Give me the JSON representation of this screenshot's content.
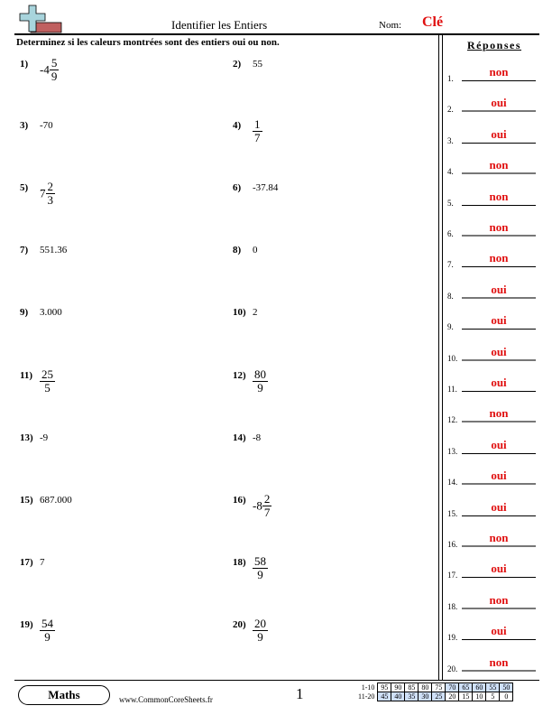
{
  "header": {
    "title": "Identifier les Entiers",
    "name_label": "Nom:",
    "name_value": "Clé",
    "instructions": "Determinez si les caleurs montrées sont des entiers oui ou non."
  },
  "questions": [
    {
      "number": "1)",
      "type": "mixed",
      "whole": "-4",
      "numerator": "5",
      "denominator": "9"
    },
    {
      "number": "2)",
      "type": "text",
      "value": "55"
    },
    {
      "number": "3)",
      "type": "text",
      "value": "-70"
    },
    {
      "number": "4)",
      "type": "fraction",
      "numerator": "1",
      "denominator": "7"
    },
    {
      "number": "5)",
      "type": "mixed",
      "whole": "7",
      "numerator": "2",
      "denominator": "3"
    },
    {
      "number": "6)",
      "type": "text",
      "value": "-37.84"
    },
    {
      "number": "7)",
      "type": "text",
      "value": "551.36"
    },
    {
      "number": "8)",
      "type": "text",
      "value": "0"
    },
    {
      "number": "9)",
      "type": "text",
      "value": "3.000"
    },
    {
      "number": "10)",
      "type": "text",
      "value": "2"
    },
    {
      "number": "11)",
      "type": "fraction",
      "numerator": "25",
      "denominator": "5"
    },
    {
      "number": "12)",
      "type": "fraction",
      "numerator": "80",
      "denominator": "9"
    },
    {
      "number": "13)",
      "type": "text",
      "value": "-9"
    },
    {
      "number": "14)",
      "type": "text",
      "value": "-8"
    },
    {
      "number": "15)",
      "type": "text",
      "value": "687.000"
    },
    {
      "number": "16)",
      "type": "mixed",
      "whole": "-8",
      "numerator": "2",
      "denominator": "7"
    },
    {
      "number": "17)",
      "type": "text",
      "value": "7"
    },
    {
      "number": "18)",
      "type": "fraction",
      "numerator": "58",
      "denominator": "9"
    },
    {
      "number": "19)",
      "type": "fraction",
      "numerator": "54",
      "denominator": "9"
    },
    {
      "number": "20)",
      "type": "fraction",
      "numerator": "20",
      "denominator": "9"
    }
  ],
  "answers": {
    "title": "Réponses",
    "items": [
      {
        "label": "1.",
        "value": "non"
      },
      {
        "label": "2.",
        "value": "oui"
      },
      {
        "label": "3.",
        "value": "oui"
      },
      {
        "label": "4.",
        "value": "non"
      },
      {
        "label": "5.",
        "value": "non"
      },
      {
        "label": "6.",
        "value": "non"
      },
      {
        "label": "7.",
        "value": "non"
      },
      {
        "label": "8.",
        "value": "oui"
      },
      {
        "label": "9.",
        "value": "oui"
      },
      {
        "label": "10.",
        "value": "oui"
      },
      {
        "label": "11.",
        "value": "oui"
      },
      {
        "label": "12.",
        "value": "non"
      },
      {
        "label": "13.",
        "value": "oui"
      },
      {
        "label": "14.",
        "value": "oui"
      },
      {
        "label": "15.",
        "value": "oui"
      },
      {
        "label": "16.",
        "value": "non"
      },
      {
        "label": "17.",
        "value": "oui"
      },
      {
        "label": "18.",
        "value": "non"
      },
      {
        "label": "19.",
        "value": "oui"
      },
      {
        "label": "20.",
        "value": "non"
      }
    ]
  },
  "footer": {
    "badge": "Maths",
    "website": "www.CommonCoreSheets.fr",
    "page_number": "1",
    "score_rows": [
      {
        "label": "1-10",
        "values": [
          "95",
          "90",
          "85",
          "80",
          "75",
          "70",
          "65",
          "60",
          "55",
          "50"
        ],
        "highlight_from": 5,
        "highlight_to": 9
      },
      {
        "label": "11-20",
        "values": [
          "45",
          "40",
          "35",
          "30",
          "25",
          "20",
          "15",
          "10",
          "5",
          "0"
        ],
        "highlight_from": 0,
        "highlight_to": 4
      }
    ]
  },
  "colors": {
    "answer": "#e01010",
    "score_highlight": "#cfe0f8",
    "logo_cross": "#a8d4dc",
    "logo_bar": "#c06060"
  }
}
